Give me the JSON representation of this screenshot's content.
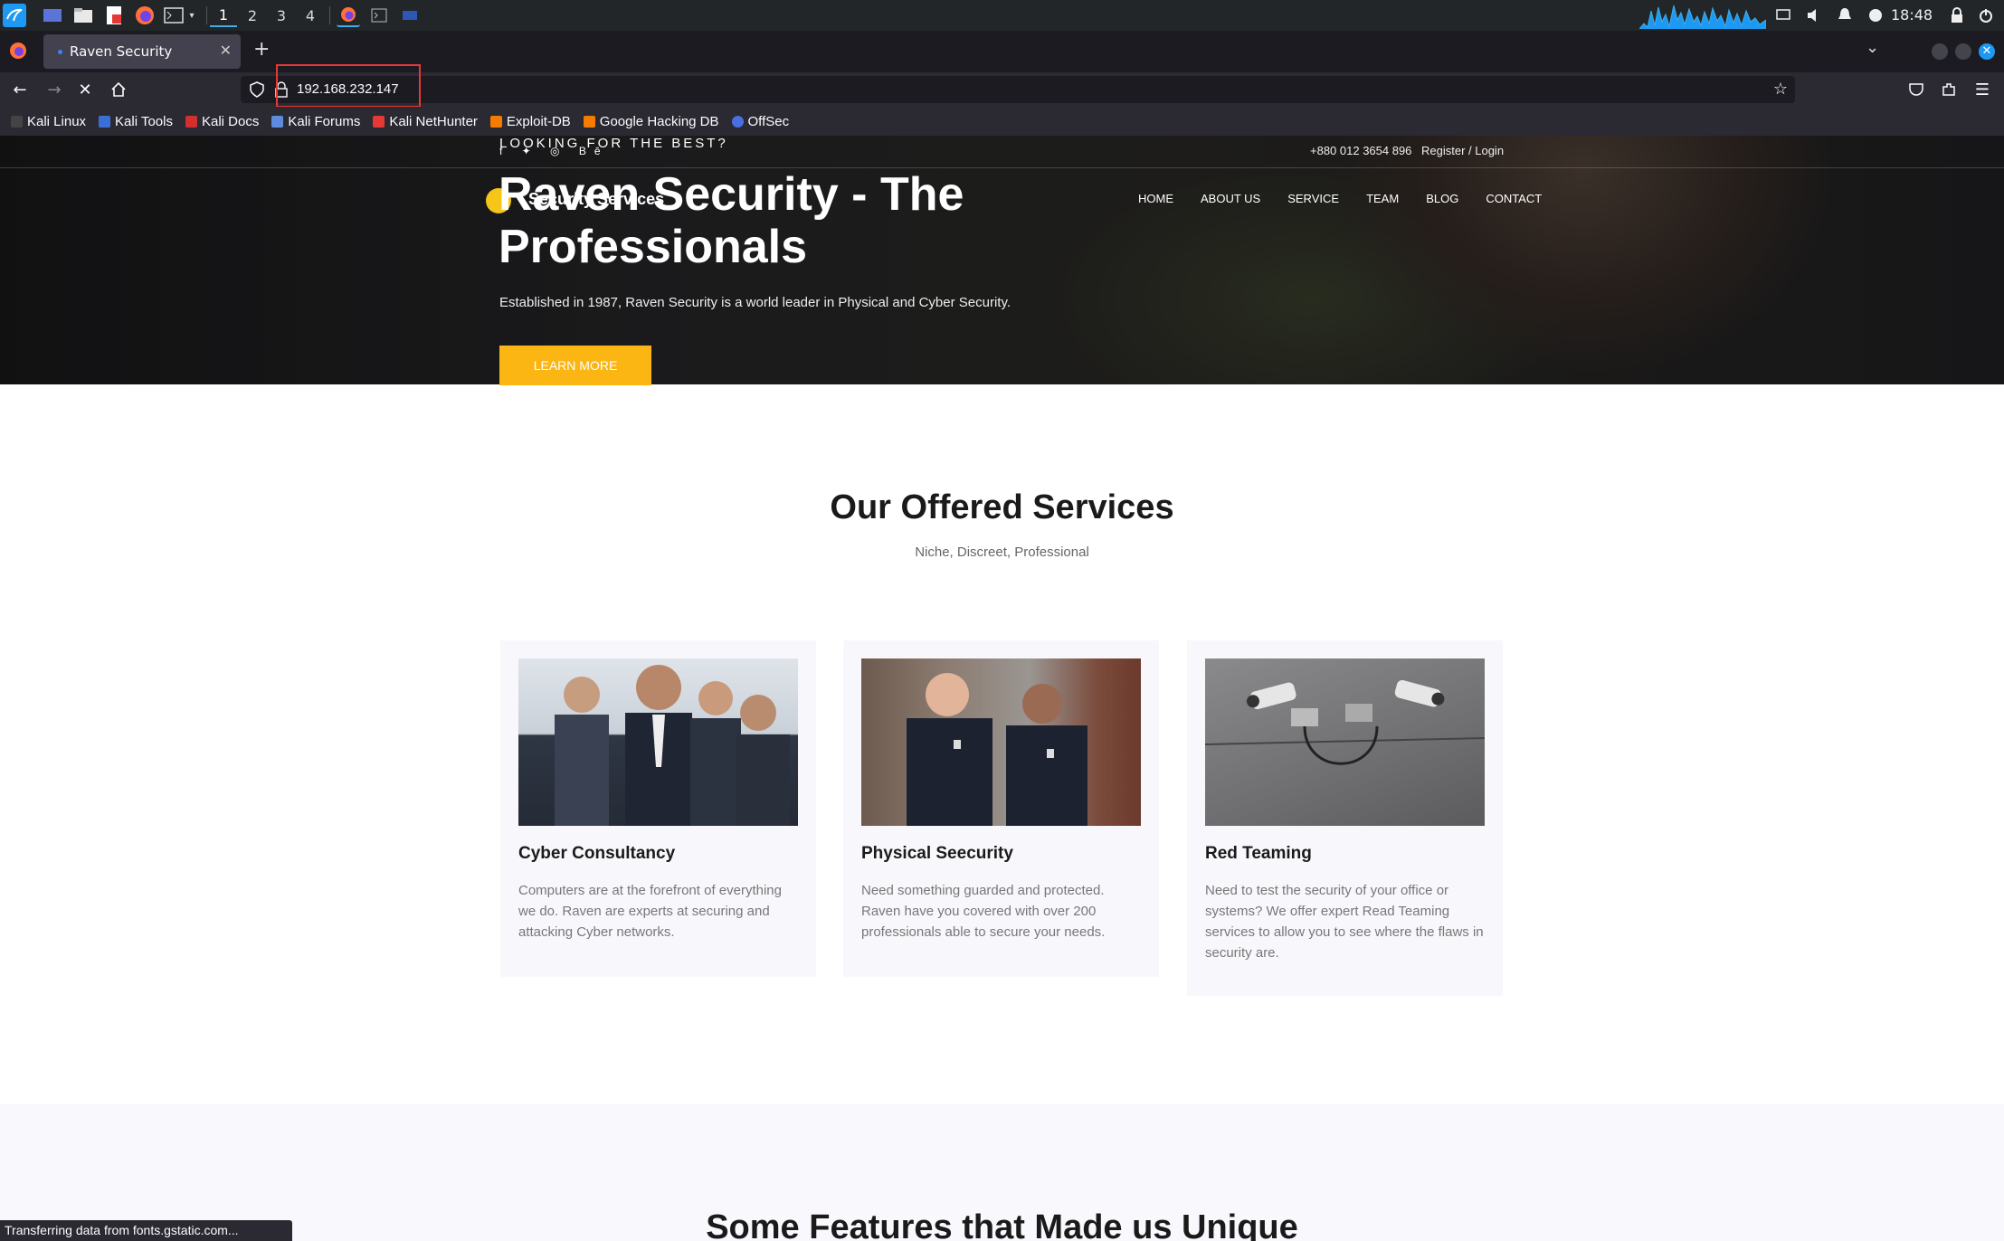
{
  "taskbar": {
    "workspaces": [
      "1",
      "2",
      "3",
      "4"
    ],
    "clock": "18:48"
  },
  "browser": {
    "tab_title": "Raven Security",
    "url": "192.168.232.147",
    "bookmarks": [
      "Kali Linux",
      "Kali Tools",
      "Kali Docs",
      "Kali Forums",
      "Kali NetHunter",
      "Exploit-DB",
      "Google Hacking DB",
      "OffSec"
    ],
    "status": "Transferring data from fonts.gstatic.com..."
  },
  "site": {
    "topbar": {
      "tagline": "LOOKING FOR THE BEST?",
      "socials": "f  ✦  ◎  Bē",
      "phone": "+880 012 3654 896",
      "login": "Register / Login"
    },
    "logo_text": "Security Services",
    "nav": [
      "HOME",
      "ABOUT US",
      "SERVICE",
      "TEAM",
      "BLOG",
      "CONTACT"
    ],
    "hero": {
      "title": "Raven Security - The Professionals",
      "subtitle": "Established in 1987, Raven Security is a world leader in Physical and Cyber Security.",
      "button": "LEARN MORE"
    },
    "services": {
      "title": "Our Offered Services",
      "subtitle": "Niche, Discreet, Professional",
      "cards": [
        {
          "title": "Cyber Consultancy",
          "text": "Computers are at the forefront of everything we do. Raven are experts at securing and attacking Cyber networks."
        },
        {
          "title": "Physical Seecurity",
          "text": "Need something guarded and protected. Raven have you covered with over 200 professionals able to secure your needs."
        },
        {
          "title": "Red Teaming",
          "text": "Need to test the security of your office or systems? We offer expert Read Teaming services to allow you to see where the flaws in security are."
        }
      ]
    },
    "features_title": "Some Features that Made us Unique"
  },
  "colors": {
    "accent": "#fcb614",
    "taskbar": "#232629",
    "chrome": "#2b2a33"
  }
}
